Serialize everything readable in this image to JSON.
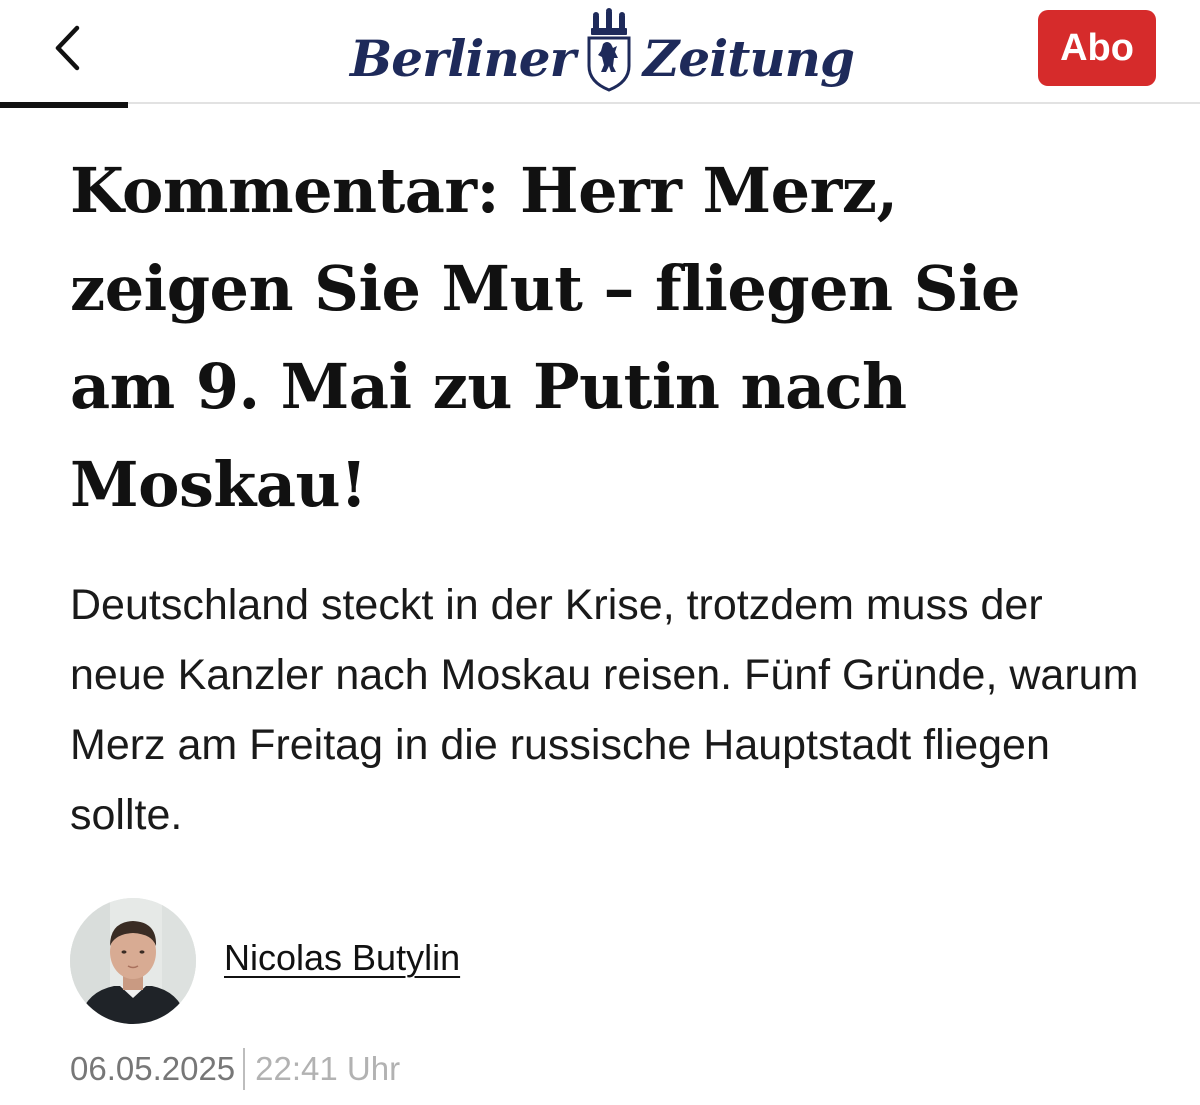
{
  "header": {
    "back_icon": "chevron-left-icon",
    "logo": {
      "word1": "Berliner",
      "crest_icon": "berlin-bear-crest-icon",
      "word2": "Zeitung",
      "color": "#1e2a5a"
    },
    "subscribe_label": "Abo",
    "subscribe_color": "#d62b2b"
  },
  "article": {
    "headline": "Kommentar: Herr Merz, zeigen Sie Mut – fliegen Sie am 9. Mai zu Putin nach Moskau!",
    "teaser": "Deutschland steckt in der Krise, trotzdem muss der neue Kanzler nach Moskau reisen. Fünf Gründe, warum Merz am Freitag in die russische Hauptstadt fliegen sollte.",
    "author": {
      "name": "Nicolas Butylin",
      "avatar_icon": "author-photo"
    },
    "date": "06.05.2025",
    "time": "22:41 Uhr"
  }
}
